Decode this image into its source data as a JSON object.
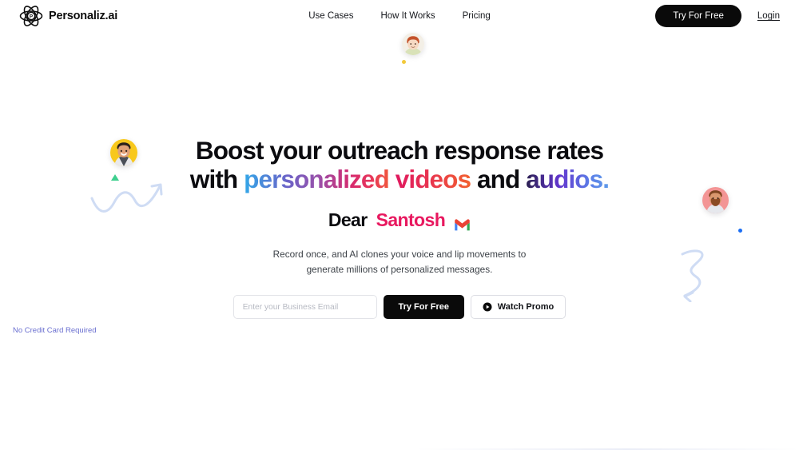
{
  "header": {
    "brand": {
      "name": "Personaliz.ai",
      "logo_icon": "atom-logo-icon"
    },
    "nav": [
      {
        "label": "Use Cases"
      },
      {
        "label": "How It Works"
      },
      {
        "label": "Pricing"
      }
    ],
    "try_free_label": "Try For Free",
    "login_label": "Login"
  },
  "hero": {
    "headline": {
      "line1": "Boost your outreach response rates",
      "line2_prefix": "with ",
      "line2_personalized": "personalized",
      "line2_space1": " ",
      "line2_videos": "videos",
      "line2_and": " and ",
      "line2_audios": "audios."
    },
    "greeting": {
      "prefix": "Dear",
      "name": "Santosh",
      "icon": "gmail-icon"
    },
    "subheadline": {
      "line1": "Record once, and AI clones your voice and lip movements to",
      "line2": "generate millions of personalized messages."
    },
    "form": {
      "email_placeholder": "Enter your Business Email",
      "email_value": "",
      "try_free_label": "Try For Free",
      "watch_promo_label": "Watch Promo",
      "watch_promo_icon": "play-circle-icon",
      "credit_note": "No Credit Card Required"
    },
    "decor": {
      "avatar_top": "avatar-woman-redhair",
      "avatar_left": "avatar-man-yellow-bg",
      "avatar_right": "avatar-man-pink-bg",
      "dot_yellow": "#F2C93B",
      "dot_blue": "#1B6EF3",
      "triangle_green": "#3ECF8E",
      "squiggle_color": "#CFDCF4"
    }
  },
  "theme": {
    "accent_dark": "#0a0a0a",
    "accent_pink": "#E8185F",
    "accent_periwinkle": "#6a6fd0",
    "text_primary": "#0b0b0f",
    "text_secondary": "#3d4248",
    "border": "#e2e3e8",
    "background": "#ffffff"
  }
}
